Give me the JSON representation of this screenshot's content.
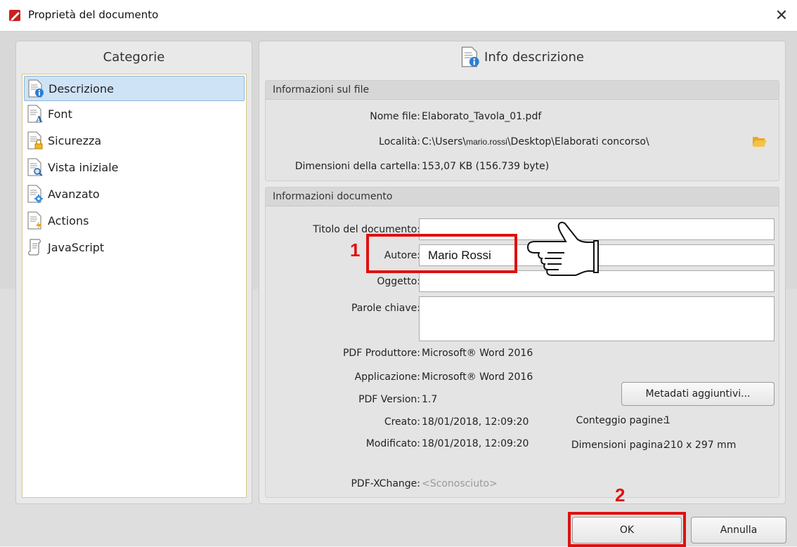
{
  "window": {
    "title": "Proprietà del documento",
    "close": "✕"
  },
  "left": {
    "header": "Categorie",
    "items": [
      {
        "label": "Descrizione",
        "icon": "doc-info-icon",
        "selected": true
      },
      {
        "label": "Font",
        "icon": "doc-font-icon"
      },
      {
        "label": "Sicurezza",
        "icon": "doc-lock-icon"
      },
      {
        "label": "Vista iniziale",
        "icon": "doc-view-icon"
      },
      {
        "label": "Avanzato",
        "icon": "doc-gear-icon"
      },
      {
        "label": "Actions",
        "icon": "doc-action-icon"
      },
      {
        "label": "JavaScript",
        "icon": "script-icon"
      }
    ]
  },
  "right": {
    "header": "Info descrizione",
    "file_group": {
      "title": "Informazioni sul file",
      "filename_label": "Nome file:",
      "filename": "Elaborato_Tavola_01.pdf",
      "location_label": "Località:",
      "location_a": "C:\\Users\\",
      "location_b": "mario.rossi",
      "location_c": "\\Desktop\\Elaborati concorso\\",
      "size_label": "Dimensioni della cartella:",
      "size": "153,07 KB (156.739 byte)"
    },
    "doc_group": {
      "title": "Informazioni documento",
      "title_label": "Titolo del documento:",
      "title_value": "",
      "author_label": "Autore:",
      "author_value": "Mario Rossi",
      "subject_label": "Oggetto:",
      "subject_value": "",
      "keywords_label": "Parole chiave:",
      "keywords_value": "",
      "producer_label": "PDF Produttore:",
      "producer": "Microsoft® Word 2016",
      "app_label": "Applicazione:",
      "app": "Microsoft® Word 2016",
      "version_label": "PDF Version:",
      "version": "1.7",
      "metadata_button": "Metadati aggiuntivi...",
      "created_label": "Creato:",
      "created": "18/01/2018, 12:09:20",
      "modified_label": "Modificato:",
      "modified": "18/01/2018, 12:09:20",
      "pages_label": "Conteggio pagine:",
      "pages": "1",
      "pagesize_label": "Dimensioni pagina:",
      "pagesize": "210 x 297 mm",
      "xchange_label": "PDF-XChange:",
      "xchange": "<Sconosciuto>"
    }
  },
  "buttons": {
    "ok": "OK",
    "cancel": "Annulla"
  },
  "annotations": {
    "one": "1",
    "two": "2"
  },
  "colors": {
    "highlight": "#e01010",
    "selection": "#cfe3f7",
    "folder": "#f2c031"
  }
}
